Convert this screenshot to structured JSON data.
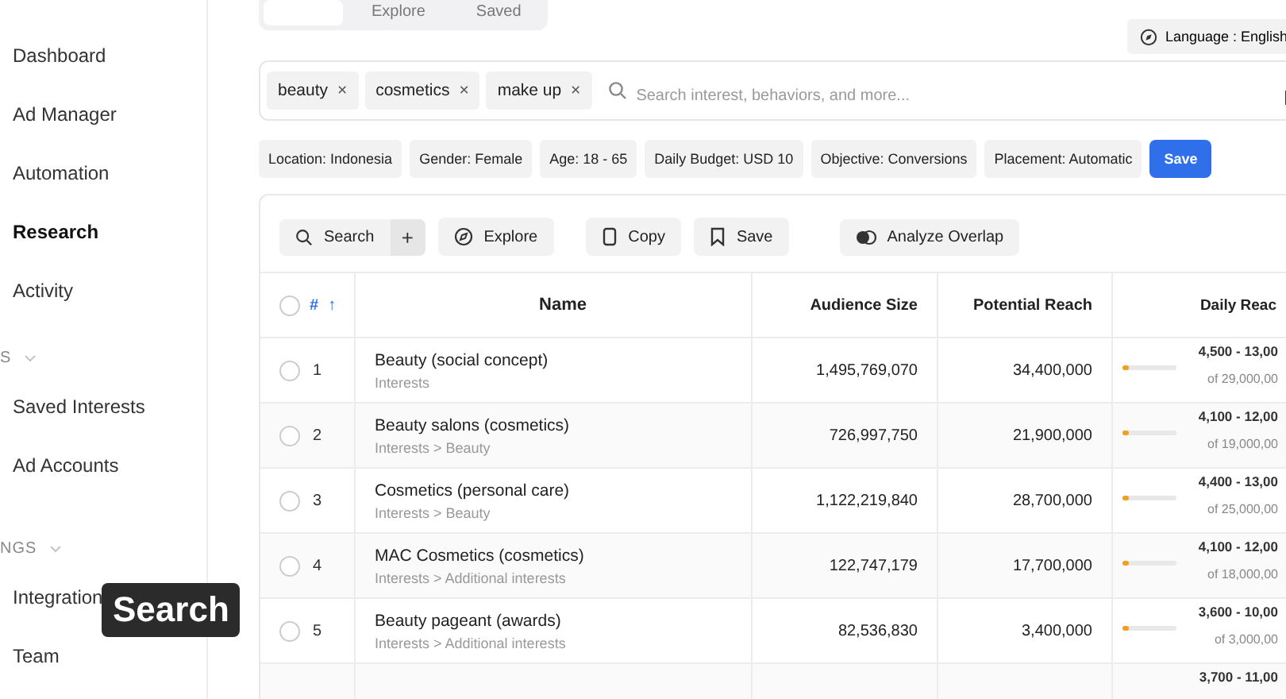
{
  "top_tabs": [
    {
      "label": "Explore",
      "selected": false
    },
    {
      "label": "Saved",
      "selected": false
    }
  ],
  "language_button": "Language : English",
  "sidebar": {
    "items": [
      {
        "label": "Dashboard",
        "selected": false
      },
      {
        "label": "Ad Manager",
        "selected": false
      },
      {
        "label": "Automation",
        "selected": false
      },
      {
        "label": "Research",
        "selected": true
      },
      {
        "label": "Activity",
        "selected": false
      }
    ],
    "sections": [
      {
        "title": "S",
        "items": [
          {
            "label": "Saved Interests",
            "selected": false
          },
          {
            "label": "Ad Accounts",
            "selected": false
          }
        ]
      },
      {
        "title": "NGS",
        "items": [
          {
            "label": "Integration",
            "selected": false
          },
          {
            "label": "Team",
            "selected": false
          }
        ]
      }
    ]
  },
  "tooltip": "Search",
  "tags": [
    {
      "label": "beauty",
      "remove": "×"
    },
    {
      "label": "cosmetics",
      "remove": "×"
    },
    {
      "label": "make up",
      "remove": "×"
    }
  ],
  "search": {
    "placeholder": "Search interest, behaviors, and more..."
  },
  "filters": [
    "Location: Indonesia",
    "Gender: Female",
    "Age: 18 - 65",
    "Daily Budget: USD 10",
    "Objective: Conversions",
    "Placement: Automatic"
  ],
  "save_filters_button": "Save",
  "toolbar": {
    "search_button": "Search",
    "add_button": "+",
    "buttons": [
      {
        "kind": "explore",
        "label": "Explore"
      },
      {
        "kind": "copy",
        "label": "Copy"
      },
      {
        "kind": "save",
        "label": "Save"
      },
      {
        "kind": "overlap",
        "label": "Analyze Overlap"
      }
    ]
  },
  "table": {
    "select_all_checked": false,
    "sort_arrow": "↑",
    "columns": [
      "#",
      "Name",
      "Audience Size",
      "Potential Reach",
      "Daily Reac"
    ],
    "rows": [
      {
        "checked": false,
        "num": "1",
        "name": "Beauty (social concept)",
        "path": "Interests",
        "audience": "1,495,769,070",
        "reach": "34,400,000",
        "range": "4,500 - 13,00",
        "of": "of 29,000,00",
        "level": 0.12
      },
      {
        "checked": false,
        "num": "2",
        "name": "Beauty salons (cosmetics)",
        "path": "Interests > Beauty",
        "audience": "726,997,750",
        "reach": "21,900,000",
        "range": "4,100 - 12,00",
        "of": "of 19,000,00",
        "level": 0.12
      },
      {
        "checked": false,
        "num": "3",
        "name": "Cosmetics (personal care)",
        "path": "Interests > Beauty",
        "audience": "1,122,219,840",
        "reach": "28,700,000",
        "range": "4,400 - 13,00",
        "of": "of 25,000,00",
        "level": 0.12
      },
      {
        "checked": false,
        "num": "4",
        "name": "MAC Cosmetics (cosmetics)",
        "path": "Interests > Additional interests",
        "audience": "122,747,179",
        "reach": "17,700,000",
        "range": "4,100 - 12,00",
        "of": "of 18,000,00",
        "level": 0.12
      },
      {
        "checked": false,
        "num": "5",
        "name": "Beauty pageant (awards)",
        "path": "Interests > Additional interests",
        "audience": "82,536,830",
        "reach": "3,400,000",
        "range": "3,600 - 10,00",
        "of": "of 3,000,00",
        "level": 0.12
      },
      {
        "range": "3,700 - 11,00"
      }
    ]
  }
}
